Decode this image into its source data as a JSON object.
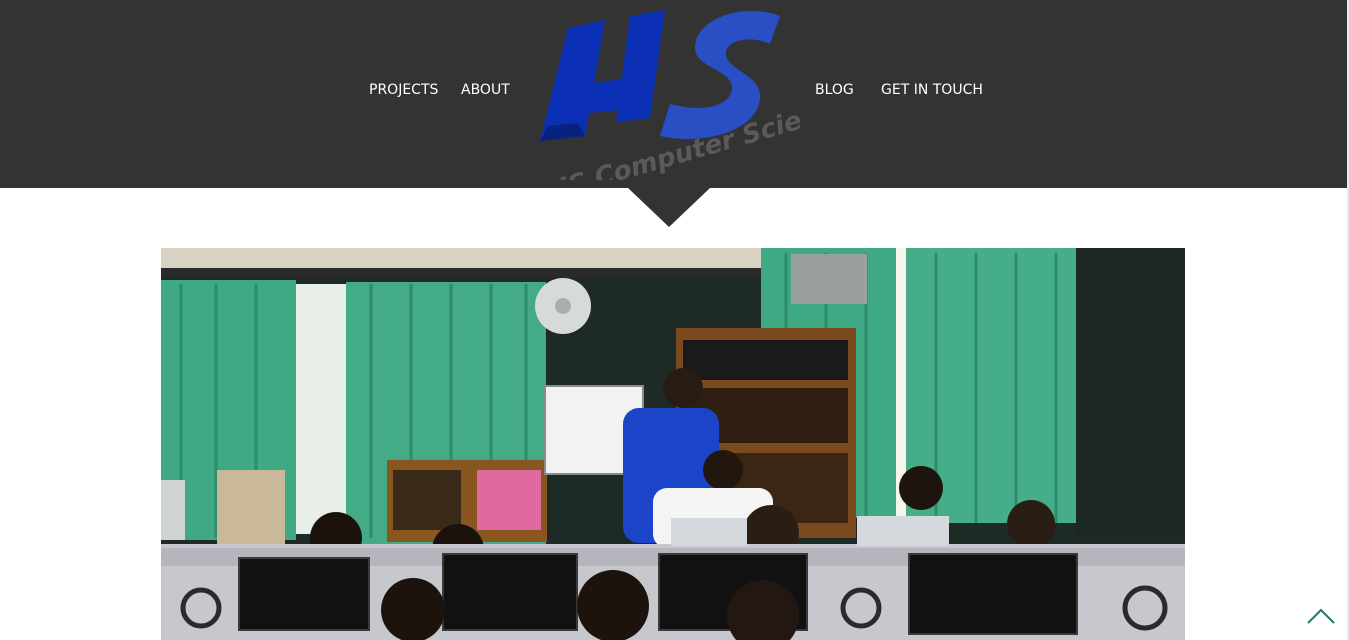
{
  "nav": {
    "left": [
      {
        "label": "PROJECTS"
      },
      {
        "label": "ABOUT"
      }
    ],
    "right": [
      {
        "label": "BLOG"
      },
      {
        "label": "GET IN TOUCH"
      }
    ]
  },
  "logo": {
    "text": "HS Computer Science",
    "primary_color": "#0a2fb5",
    "secondary_color": "#4a4a4a"
  },
  "hero": {
    "image_description": "Students working at computers in a classroom with green curtains",
    "accent": "#3fa983"
  },
  "back_to_top": {
    "icon": "chevron-up-icon",
    "color": "#1a7a6a"
  },
  "colors": {
    "header_bg": "#333333",
    "nav_text": "#ffffff",
    "page_bg": "#ffffff"
  }
}
